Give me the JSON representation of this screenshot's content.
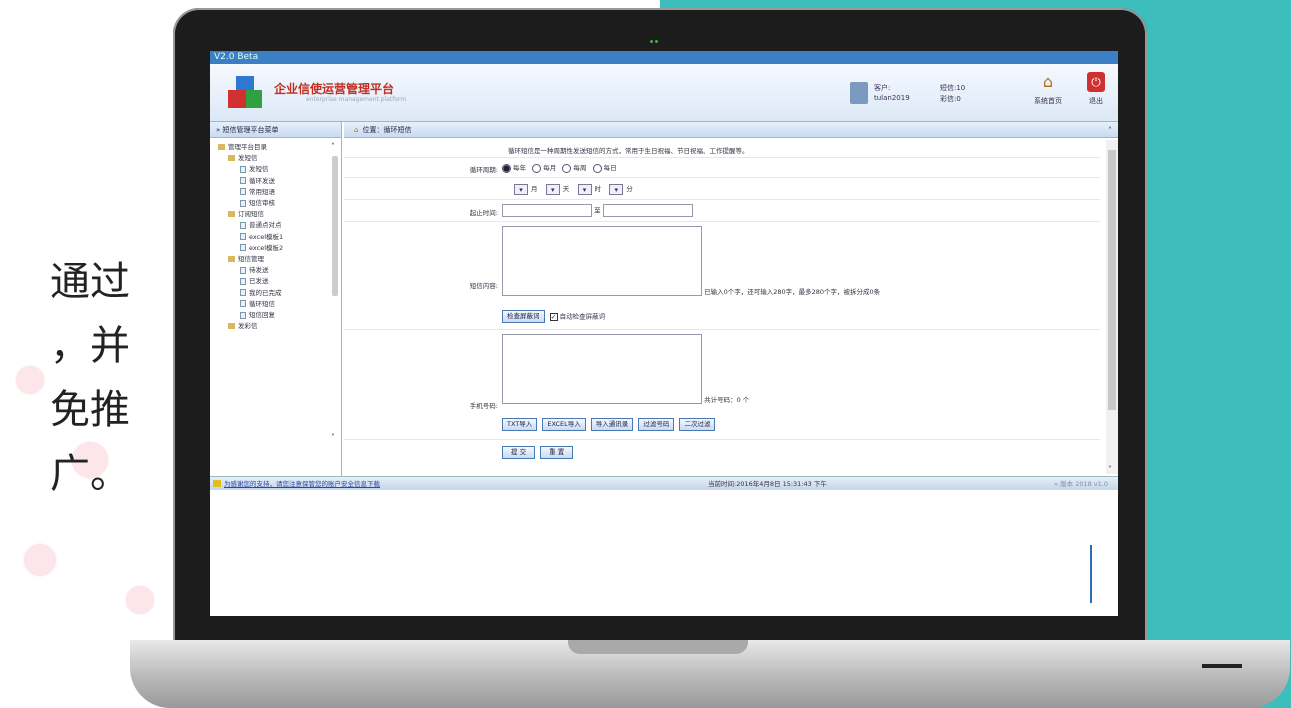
{
  "side_text": [
    "通过",
    "，并",
    "免推",
    "广。"
  ],
  "app": {
    "window_title": "V2.0 Beta",
    "title": "企业信使运营管理平台",
    "subtitle": "enterprise management platform",
    "user_label": "客户:",
    "username": "tulan2019",
    "sms_balance": "短信:10",
    "mms_balance": "彩信:0",
    "home_button": "系统首页",
    "exit_button": "退出"
  },
  "sidebar": {
    "header": "» 短信管理平台菜单",
    "root": "管理平台目录",
    "items": [
      {
        "label": "发短信",
        "level": 1
      },
      {
        "label": "发短信",
        "level": 2
      },
      {
        "label": "循环发送",
        "level": 2
      },
      {
        "label": "常用短语",
        "level": 2
      },
      {
        "label": "短信审核",
        "level": 2
      },
      {
        "label": "订阅短信",
        "level": 1
      },
      {
        "label": "普通点对点",
        "level": 2
      },
      {
        "label": "excel模板1",
        "level": 2
      },
      {
        "label": "excel模板2",
        "level": 2
      },
      {
        "label": "短信管理",
        "level": 1
      },
      {
        "label": "待发送",
        "level": 2
      },
      {
        "label": "已发送",
        "level": 2
      },
      {
        "label": "我的已完成",
        "level": 2
      },
      {
        "label": "循环短信",
        "level": 2
      },
      {
        "label": "短信回复",
        "level": 2
      },
      {
        "label": "发彩信",
        "level": 1
      }
    ]
  },
  "main": {
    "breadcrumb": "位置：循环短信",
    "description": "循环短信是一种周期性发送短信的方式，常用于生日祝福、节日祝福、工作提醒等。",
    "cycle_label": "循环周期:",
    "cycle_options": [
      "每年",
      "每月",
      "每周",
      "每日"
    ],
    "cycle_selected": "每年",
    "time_units": [
      "月",
      "天",
      "时",
      "分"
    ],
    "date_label": "起止时间:",
    "date_separator": "至",
    "content_label": "短信内容:",
    "content_counter": "已输入0个字，还可输入280字，最多280个字，被拆分成0条",
    "check_keywords_button": "检查屏蔽词",
    "auto_check_label": "自动检查屏蔽词",
    "auto_check_checked": true,
    "phone_label": "手机号码:",
    "phone_count": "共计号码：0 个",
    "import_buttons": [
      "TXT导入",
      "EXCEL导入",
      "导入通讯录",
      "过滤号码",
      "二次过滤"
    ],
    "submit_button": "提 交",
    "reset_button": "重 置"
  },
  "status": {
    "message": "为感谢您的支持，请您注意保管您的账户安全信息下载",
    "time": "当前时间:2016年4月8日 15:31:43 下午",
    "version": "» 版本 2018 v1.0"
  }
}
